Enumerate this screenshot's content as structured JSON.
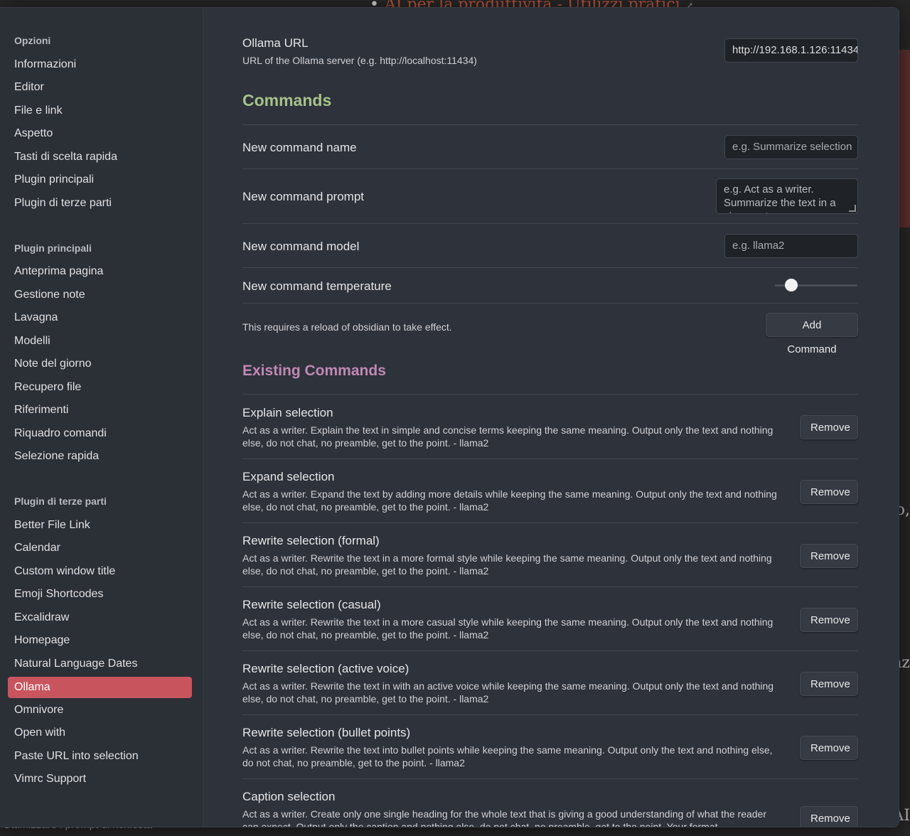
{
  "background": {
    "heading": "AI per la produttività - Utilizzi pratici",
    "frag_1": "o,",
    "frag_2": "nz",
    "frag_3": "AI",
    "bottom_text": "Ottimizzare i prompt di richiesta"
  },
  "sidebar": {
    "sections": [
      {
        "title": "Opzioni",
        "items": [
          "Informazioni",
          "Editor",
          "File e link",
          "Aspetto",
          "Tasti di scelta rapida",
          "Plugin principali",
          "Plugin di terze parti"
        ]
      },
      {
        "title": "Plugin principali",
        "items": [
          "Anteprima pagina",
          "Gestione note",
          "Lavagna",
          "Modelli",
          "Note del giorno",
          "Recupero file",
          "Riferimenti",
          "Riquadro comandi",
          "Selezione rapida"
        ]
      },
      {
        "title": "Plugin di terze parti",
        "items": [
          "Better File Link",
          "Calendar",
          "Custom window title",
          "Emoji Shortcodes",
          "Excalidraw",
          "Homepage",
          "Natural Language Dates",
          "Ollama",
          "Omnivore",
          "Open with",
          "Paste URL into selection",
          "Vimrc Support"
        ]
      }
    ],
    "active": "Ollama"
  },
  "settings": {
    "ollama_url": {
      "name": "Ollama URL",
      "desc": "URL of the Ollama server (e.g. http://localhost:11434)",
      "value": "http://192.168.1.126:11434"
    },
    "commands_heading": "Commands",
    "new_name": {
      "name": "New command name",
      "placeholder": "e.g. Summarize selection"
    },
    "new_prompt": {
      "name": "New command prompt",
      "placeholder": "e.g. Act as a writer. Summarize the text in a view sentences highlighting the key takeaways."
    },
    "new_model": {
      "name": "New command model",
      "placeholder": "e.g. llama2"
    },
    "new_temperature": {
      "name": "New command temperature",
      "value": 0.2
    },
    "reload_note": "This requires a reload of obsidian to take effect.",
    "add_button": "Add Command",
    "existing_heading": "Existing Commands",
    "remove_label": "Remove"
  },
  "commands": [
    {
      "name": "Explain selection",
      "desc": "Act as a writer. Explain the text in simple and concise terms keeping the same meaning. Output only the text and nothing else, do not chat, no preamble, get to the point. - llama2"
    },
    {
      "name": "Expand selection",
      "desc": "Act as a writer. Expand the text by adding more details while keeping the same meaning. Output only the text and nothing else, do not chat, no preamble, get to the point. - llama2"
    },
    {
      "name": "Rewrite selection (formal)",
      "desc": "Act as a writer. Rewrite the text in a more formal style while keeping the same meaning. Output only the text and nothing else, do not chat, no preamble, get to the point. - llama2"
    },
    {
      "name": "Rewrite selection (casual)",
      "desc": "Act as a writer. Rewrite the text in a more casual style while keeping the same meaning. Output only the text and nothing else, do not chat, no preamble, get to the point. - llama2"
    },
    {
      "name": "Rewrite selection (active voice)",
      "desc": "Act as a writer. Rewrite the text in with an active voice while keeping the same meaning. Output only the text and nothing else, do not chat, no preamble, get to the point. - llama2"
    },
    {
      "name": "Rewrite selection (bullet points)",
      "desc": "Act as a writer. Rewrite the text into bullet points while keeping the same meaning. Output only the text and nothing else, do not chat, no preamble, get to the point. - llama2"
    },
    {
      "name": "Caption selection",
      "desc": "Act as a writer. Create only one single heading for the whole text that is giving a good understanding of what the reader can expect. Output only the caption and nothing else, do not chat, no preamble, get to the point. Your format"
    }
  ],
  "icons": {
    "close": "close-icon",
    "external_link": "external-link-icon"
  },
  "colors": {
    "accent": "#c8555e",
    "commands_heading": "#a6c28a",
    "existing_heading": "#c089b4"
  }
}
